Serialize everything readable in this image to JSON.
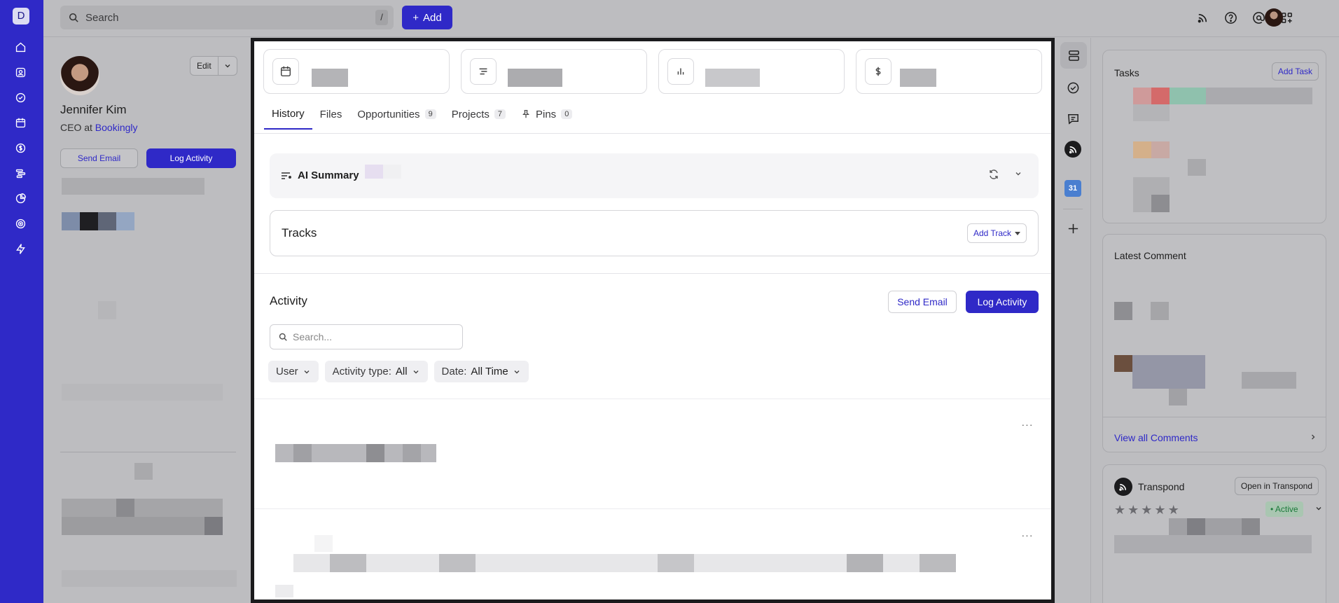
{
  "app": {
    "logo_letter": "D"
  },
  "nav": {
    "items": [
      "home-icon",
      "contacts-icon",
      "tasks-icon",
      "calendar-icon",
      "deals-icon",
      "projects-icon",
      "reports-icon",
      "goals-icon",
      "automations-icon"
    ]
  },
  "topbar": {
    "search_placeholder": "Search",
    "search_shortcut": "/",
    "add_label": "Add"
  },
  "profile": {
    "name": "Jennifer Kim",
    "role_prefix": "CEO at",
    "company": "Bookingly",
    "edit_label": "Edit",
    "send_email_label": "Send Email",
    "log_activity_label": "Log Activity"
  },
  "main": {
    "tabs": [
      {
        "label": "History",
        "count": null
      },
      {
        "label": "Files",
        "count": null
      },
      {
        "label": "Opportunities",
        "count": "9"
      },
      {
        "label": "Projects",
        "count": "7"
      },
      {
        "label": "Pins",
        "count": "0"
      }
    ],
    "ai_summary_label": "AI Summary",
    "tracks_label": "Tracks",
    "add_track_label": "Add Track",
    "activity_title": "Activity",
    "send_email_label": "Send Email",
    "log_activity_label": "Log Activity",
    "activity_search_placeholder": "Search...",
    "filters": {
      "user_label": "User",
      "type_key": "Activity type:",
      "type_value": "All",
      "date_key": "Date:",
      "date_value": "All Time"
    }
  },
  "right_panel": {
    "tasks_title": "Tasks",
    "add_task_label": "Add Task",
    "latest_comment_title": "Latest Comment",
    "view_all_comments_label": "View all Comments",
    "transpond_title": "Transpond",
    "open_in_transpond_label": "Open in Transpond",
    "status_label": "• Active",
    "calendar_day": "31"
  },
  "colors": {
    "accent": "#2f29c7",
    "overlay_bg": "#bdbdc0",
    "active_green": "#1b7a3a"
  }
}
